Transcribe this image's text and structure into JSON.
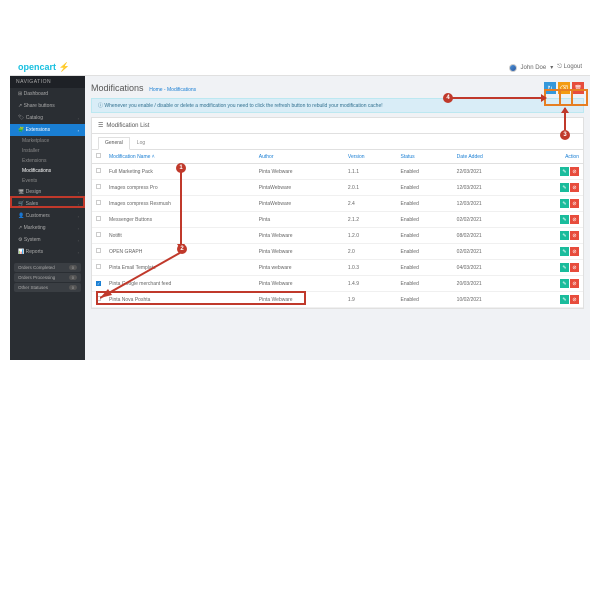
{
  "logo": "opencart ⚡",
  "user": {
    "name": "John Doe",
    "logout": "Logout"
  },
  "nav": {
    "header": "NAVIGATION",
    "items": [
      "Dashboard",
      "Share buttons",
      "Catalog",
      "Extensions",
      "Design",
      "Sales",
      "Customers",
      "Marketing",
      "System",
      "Reports"
    ],
    "sub": [
      "Marketplace",
      "Installer",
      "Extensions",
      "Modifications",
      "Events"
    ]
  },
  "badges": [
    {
      "l": "Orders Completed",
      "c": "0"
    },
    {
      "l": "Orders Processing",
      "c": "0"
    },
    {
      "l": "Other Statuses",
      "c": "0"
    }
  ],
  "page": {
    "title": "Modifications",
    "bc_home": "Home",
    "bc_sep": " - ",
    "bc_cur": "Modifications"
  },
  "alert": "Whenever you enable / disable or delete a modification you need to click the refresh button to rebuild your modification cache!",
  "panel": {
    "title": "Modification List"
  },
  "tabs": {
    "general": "General",
    "log": "Log"
  },
  "cols": {
    "name": "Modification Name",
    "author": "Author",
    "version": "Version",
    "status": "Status",
    "date": "Date Added",
    "action": "Action"
  },
  "rows": [
    {
      "n": "Full Marketing Pack",
      "a": "Pinta Webware",
      "v": "1.1.1",
      "s": "Enabled",
      "d": "22/03/2021"
    },
    {
      "n": "Images compress Pro",
      "a": "PintaWebware",
      "v": "2.0.1",
      "s": "Enabled",
      "d": "12/03/2021"
    },
    {
      "n": "Images compress Resmush",
      "a": "PintaWebware",
      "v": "2.4",
      "s": "Enabled",
      "d": "12/03/2021"
    },
    {
      "n": "Messenger Buttons",
      "a": "Pinta",
      "v": "2.1.2",
      "s": "Enabled",
      "d": "02/02/2021"
    },
    {
      "n": "Notifit",
      "a": "Pinta Webware",
      "v": "1.2.0",
      "s": "Enabled",
      "d": "08/02/2021"
    },
    {
      "n": "OPEN GRAPH",
      "a": "Pinta Webware",
      "v": "2.0",
      "s": "Enabled",
      "d": "02/02/2021"
    },
    {
      "n": "Pinta Email Template",
      "a": "Pinta webware",
      "v": "1.0.3",
      "s": "Enabled",
      "d": "04/03/2021"
    },
    {
      "n": "Pinta Google merchant feed",
      "a": "Pinta Webware",
      "v": "1.4.9",
      "s": "Enabled",
      "d": "20/03/2021",
      "ck": true
    },
    {
      "n": "Pinta Nova Poshta",
      "a": "Pinta Webware",
      "v": "1.9",
      "s": "Enabled",
      "d": "10/02/2021"
    }
  ],
  "ann": {
    "1": "1",
    "2": "2",
    "3": "3",
    "4": "4"
  }
}
